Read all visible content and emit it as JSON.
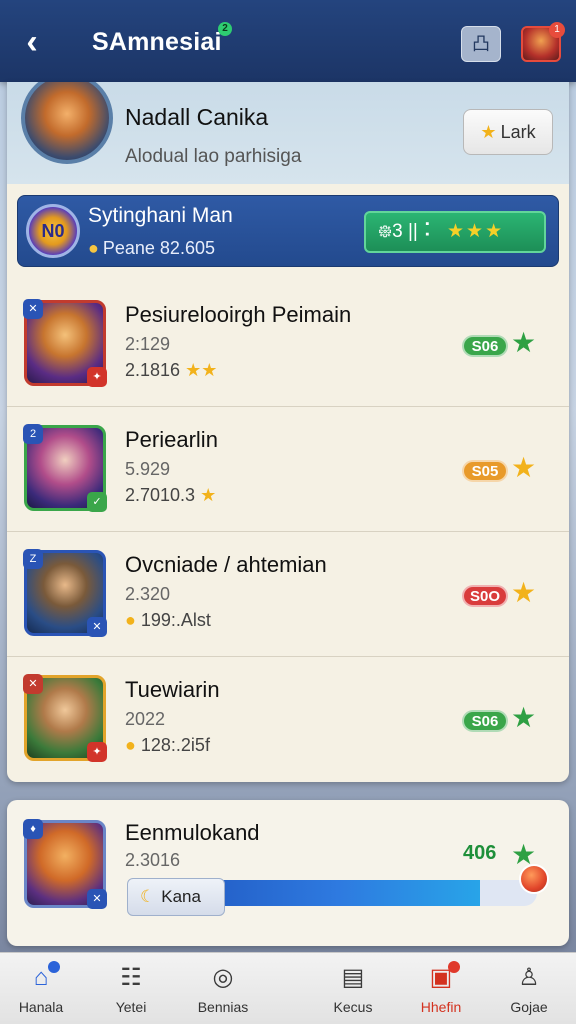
{
  "header": {
    "title": "SAmnesiai",
    "title_badge": "2",
    "back_icon": "chevron-left-icon",
    "share_icon": "share-icon",
    "share_label": "凸",
    "notification_count": "1"
  },
  "profile": {
    "name": "Nadall Canika",
    "subtitle": "Alodual lao parhisiga",
    "rank_button": "Lark"
  },
  "highlight": {
    "icon_text": "N0",
    "name": "Sytinghani Man",
    "subtitle": "Peane 82.605",
    "pill_text": "᪥3 ||  ⠅",
    "pill_stars": "★★★"
  },
  "rows": [
    {
      "name": "Pesiurelooirgh Peimain",
      "line1": "2:129",
      "line2": "2.1816",
      "line2_suffix": "★★",
      "score": "S06",
      "score_color": "#3aa64a",
      "star_color": "#2ea043"
    },
    {
      "name": "Periearlin",
      "line1": "5.929",
      "line2": "2.7010.3",
      "line2_suffix": "★",
      "score": "S05",
      "score_color": "#e89a2a",
      "star_color": "#f2b21b"
    },
    {
      "name": "Ovcniade / ahtemian",
      "line1": "2.320",
      "line2": "199:.Alst",
      "line2_suffix": "",
      "score": "S0O",
      "score_color": "#d93c3c",
      "star_color": "#f2b21b"
    },
    {
      "name": "Tuewiarin",
      "line1": "2022",
      "line2": "128:.2i5f",
      "line2_suffix": "",
      "score": "S06",
      "score_color": "#3aa64a",
      "star_color": "#2ea043"
    }
  ],
  "card": {
    "name": "Eenmulokand",
    "line1": "2.3016",
    "score": "406",
    "progress_label": "Kana",
    "progress_fraction": 0.86
  },
  "nav": [
    {
      "label": "Hanala",
      "icon": "home-icon",
      "glyph": "⌂"
    },
    {
      "label": "Yetei",
      "icon": "grid-icon",
      "glyph": "☷"
    },
    {
      "label": "Bennias",
      "icon": "search-profile-icon",
      "glyph": "◎"
    },
    {
      "label": "Kecus",
      "icon": "chat-icon",
      "glyph": "▤"
    },
    {
      "label": "Hhefin",
      "icon": "chest-icon",
      "glyph": "▣"
    },
    {
      "label": "Gojae",
      "icon": "person-icon",
      "glyph": "♙"
    }
  ]
}
